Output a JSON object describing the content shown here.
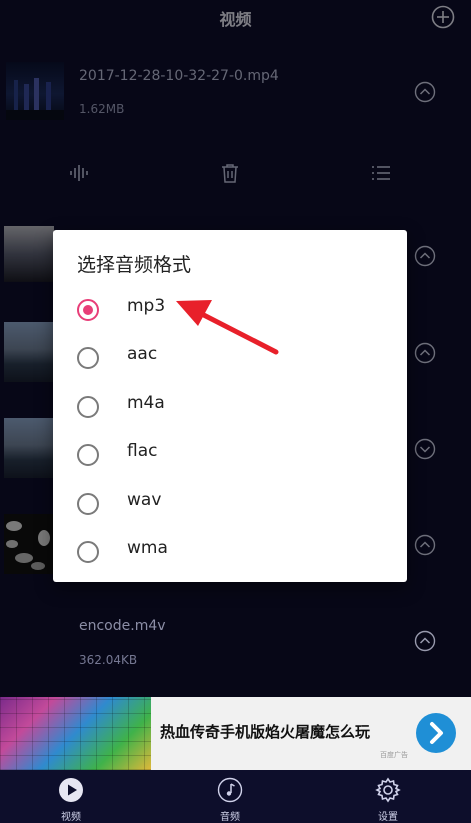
{
  "header": {
    "title": "视频",
    "add_icon": "plus-circle-icon"
  },
  "items": [
    {
      "filename": "2017-12-28-10-32-27-0.mp4",
      "size": "1.62MB"
    },
    {
      "filename": "encode.m4v",
      "size": "362.04KB"
    }
  ],
  "action_bar": {
    "icons": [
      "audio-wave-icon",
      "trash-icon",
      "list-icon"
    ]
  },
  "dialog": {
    "title": "选择音频格式",
    "options": [
      "mp3",
      "aac",
      "m4a",
      "flac",
      "wav",
      "wma"
    ],
    "selected": "mp3"
  },
  "ad": {
    "text": "热血传奇手机版焰火屠魔怎么玩",
    "tag": "百度广告"
  },
  "bottom_nav": {
    "items": [
      {
        "label": "视频",
        "icon": "play-circle-icon"
      },
      {
        "label": "音频",
        "icon": "music-note-icon"
      },
      {
        "label": "设置",
        "icon": "gear-icon"
      }
    ]
  },
  "colors": {
    "background": "#0d0e2b",
    "accent": "#e83e78",
    "annotation_arrow": "#e8202a",
    "ad_button": "#1f8fd6"
  }
}
